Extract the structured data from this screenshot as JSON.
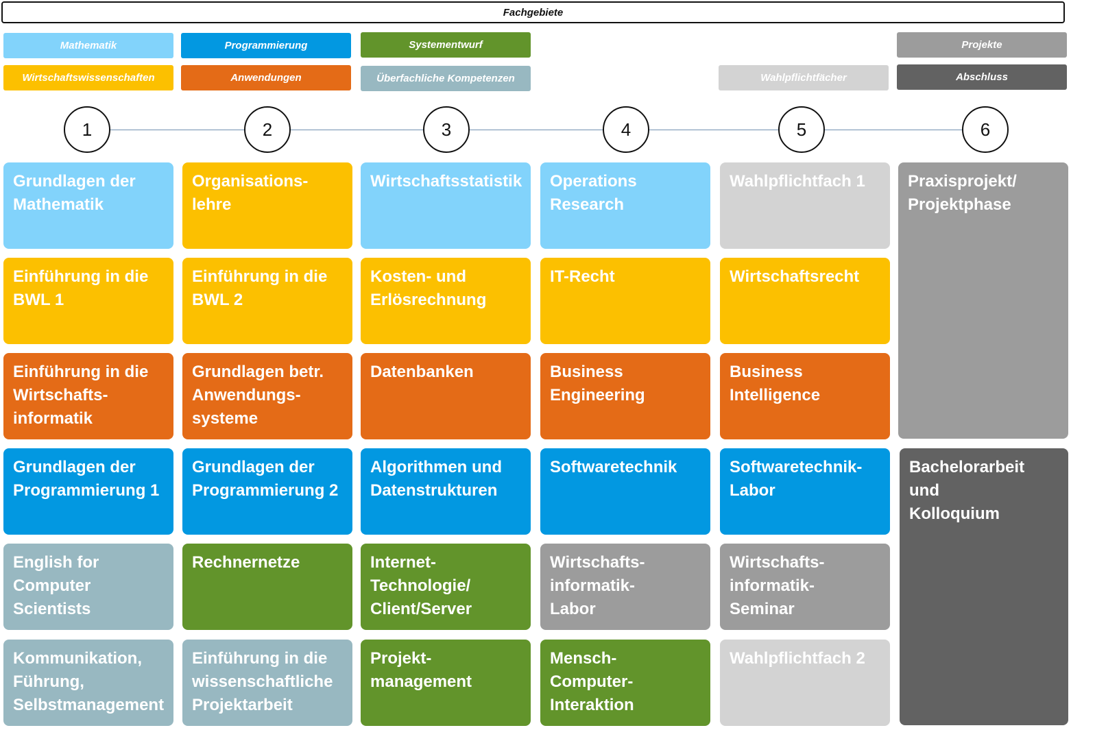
{
  "header": {
    "title": "Fachgebiete"
  },
  "colors": {
    "mathematik": "#82d3fb",
    "wirtschaft": "#fcc000",
    "anwendungen": "#e46b17",
    "programmierung": "#0298e1",
    "ueberfachlich": "#98b8c1",
    "systementwurf": "#62942b",
    "wahlpflicht": "#d3d3d3",
    "projekte": "#9c9c9c",
    "abschluss": "#626262"
  },
  "legend": [
    {
      "label": "Mathematik",
      "category": "mathematik"
    },
    {
      "label": "Programmierung",
      "category": "programmierung"
    },
    {
      "label": "Systementwurf",
      "category": "systementwurf"
    },
    {
      "label": "Projekte",
      "category": "projekte"
    },
    {
      "label": "Wirtschaftswissenschaften",
      "category": "wirtschaft"
    },
    {
      "label": "Anwendungen",
      "category": "anwendungen"
    },
    {
      "label": "Überfachliche Kompetenzen",
      "category": "ueberfachlich"
    },
    {
      "label": "Wahlpflichtfächer",
      "category": "wahlpflicht"
    },
    {
      "label": "Abschluss",
      "category": "abschluss"
    }
  ],
  "semesters": [
    "1",
    "2",
    "3",
    "4",
    "5",
    "6"
  ],
  "modules": [
    [
      {
        "title": "Grundlagen der\nMathematik",
        "category": "mathematik"
      },
      {
        "title": "Einführung in die\nBWL 1",
        "category": "wirtschaft"
      },
      {
        "title": "Einführung in die\nWirtschafts-\ninformatik",
        "category": "anwendungen"
      },
      {
        "title": "Grundlagen der\nProgrammierung 1",
        "category": "programmierung"
      },
      {
        "title": "English for\nComputer\nScientists",
        "category": "ueberfachlich"
      },
      {
        "title": "Kommunikation,\nFührung,\nSelbstmanagement",
        "category": "ueberfachlich"
      }
    ],
    [
      {
        "title": "Organisations-\nlehre",
        "category": "wirtschaft"
      },
      {
        "title": "Einführung in die\nBWL 2",
        "category": "wirtschaft"
      },
      {
        "title": "Grundlagen betr.\nAnwendungs-\nsysteme",
        "category": "anwendungen"
      },
      {
        "title": "Grundlagen der\nProgrammierung 2",
        "category": "programmierung"
      },
      {
        "title": "Rechnernetze",
        "category": "systementwurf"
      },
      {
        "title": "Einführung in die\nwissenschaftliche\nProjektarbeit",
        "category": "ueberfachlich"
      }
    ],
    [
      {
        "title": "Wirtschaftsstatistik",
        "category": "mathematik"
      },
      {
        "title": "Kosten- und\nErlösrechnung",
        "category": "wirtschaft"
      },
      {
        "title": "Datenbanken",
        "category": "anwendungen"
      },
      {
        "title": "Algorithmen und\nDatenstrukturen",
        "category": "programmierung"
      },
      {
        "title": "Internet-\nTechnologie/\nClient/Server",
        "category": "systementwurf"
      },
      {
        "title": "Projekt-\nmanagement",
        "category": "systementwurf"
      }
    ],
    [
      {
        "title": "Operations\nResearch",
        "category": "mathematik"
      },
      {
        "title": "IT-Recht",
        "category": "wirtschaft"
      },
      {
        "title": "Business\nEngineering",
        "category": "anwendungen"
      },
      {
        "title": "Softwaretechnik",
        "category": "programmierung"
      },
      {
        "title": "Wirtschafts-\ninformatik-\nLabor",
        "category": "projekte"
      },
      {
        "title": "Mensch-\nComputer-\nInteraktion",
        "category": "systementwurf"
      }
    ],
    [
      {
        "title": "Wahlpflichtfach 1",
        "category": "wahlpflicht"
      },
      {
        "title": "Wirtschaftsrecht",
        "category": "wirtschaft"
      },
      {
        "title": "Business\nIntelligence",
        "category": "anwendungen"
      },
      {
        "title": "Softwaretechnik-\nLabor",
        "category": "programmierung"
      },
      {
        "title": "Wirtschafts-\ninformatik-\nSeminar",
        "category": "projekte"
      },
      {
        "title": "Wahlpflichtfach 2",
        "category": "wahlpflicht"
      }
    ],
    [
      {
        "title": "Praxisprojekt/\nProjektphase",
        "category": "projekte"
      },
      {
        "title": "Bachelorarbeit und\nKolloquium",
        "category": "abschluss"
      }
    ]
  ]
}
